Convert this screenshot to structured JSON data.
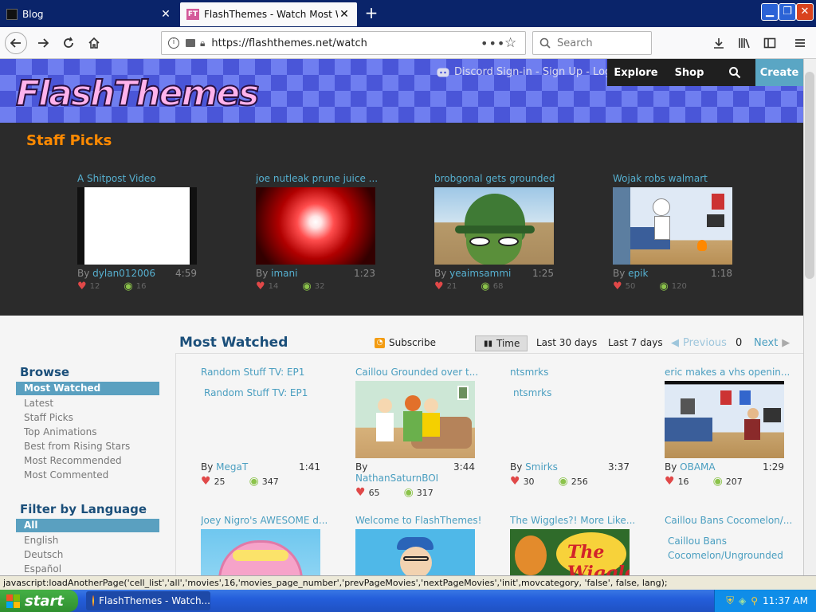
{
  "browser": {
    "tabs": [
      {
        "label": "Blog"
      },
      {
        "label": "FlashThemes - Watch Most Watched"
      }
    ],
    "url": "https://flashthemes.net/watch",
    "search_placeholder": "Search"
  },
  "site": {
    "logo_text": "FlashThemes",
    "signin_text": "Discord Sign-in - Sign Up - Login",
    "nav": {
      "explore": "Explore",
      "shop": "Shop",
      "create": "Create"
    }
  },
  "staff_picks": {
    "title": "Staff Picks",
    "items": [
      {
        "title": "A Shitpost Video",
        "author": "dylan012006",
        "duration": "4:59",
        "likes": "12",
        "views": "16"
      },
      {
        "title": "joe nutleak prune juice ...",
        "author": "imani",
        "duration": "1:23",
        "likes": "14",
        "views": "32"
      },
      {
        "title": "brobgonal gets grounded",
        "author": "yeaimsammi",
        "duration": "1:25",
        "likes": "21",
        "views": "68"
      },
      {
        "title": "Wojak robs walmart",
        "author": "epik",
        "duration": "1:18",
        "likes": "50",
        "views": "120"
      }
    ]
  },
  "most_watched": {
    "title": "Most Watched",
    "subscribe": "Subscribe",
    "filters": {
      "time": "Time",
      "last30": "Last 30 days",
      "last7": "Last 7 days"
    },
    "pager": {
      "previous": "Previous",
      "page": "0",
      "next": "Next"
    },
    "row1": [
      {
        "title": "Random Stuff TV: EP1",
        "alt": "Random Stuff TV: EP1",
        "author": "MegaT",
        "duration": "1:41",
        "likes": "25",
        "views": "347"
      },
      {
        "title": "Caillou Grounded over t...",
        "author": "NathanSaturnBOI",
        "duration": "3:44",
        "likes": "65",
        "views": "317"
      },
      {
        "title": "ntsmrks",
        "alt": "ntsmrks",
        "author": "Smirks",
        "duration": "3:37",
        "likes": "30",
        "views": "256"
      },
      {
        "title": "eric makes a vhs openin...",
        "author": "OBAMA",
        "duration": "1:29",
        "likes": "16",
        "views": "207"
      }
    ],
    "row2": [
      {
        "title": "Joey Nigro's AWESOME d..."
      },
      {
        "title": "Welcome to FlashThemes!"
      },
      {
        "title": "The Wiggles?! More Like..."
      },
      {
        "title": "Caillou Bans Cocomelon/...",
        "alt": "Caillou Bans Cocomelon/Ungrounded"
      }
    ]
  },
  "sidebar": {
    "browse_title": "Browse",
    "browse_items": [
      "Most Watched",
      "Latest",
      "Staff Picks",
      "Top Animations",
      "Best from Rising Stars",
      "Most Recommended",
      "Most Commented"
    ],
    "lang_title": "Filter by Language",
    "lang_items": [
      "All",
      "English",
      "Deutsch",
      "Español"
    ]
  },
  "status_text": "javascript:loadAnotherPage('cell_list','all','movies',16,'movies_page_number','prevPageMovies','nextPageMovies','init',movcategory, 'false', false, lang);",
  "taskbar": {
    "start": "start",
    "window": "FlashThemes - Watch...",
    "clock": "11:37 AM"
  },
  "colors": {
    "accent": "#56b0d0",
    "staff_title": "#ff8a00",
    "header_bg": "#4a56d8"
  }
}
